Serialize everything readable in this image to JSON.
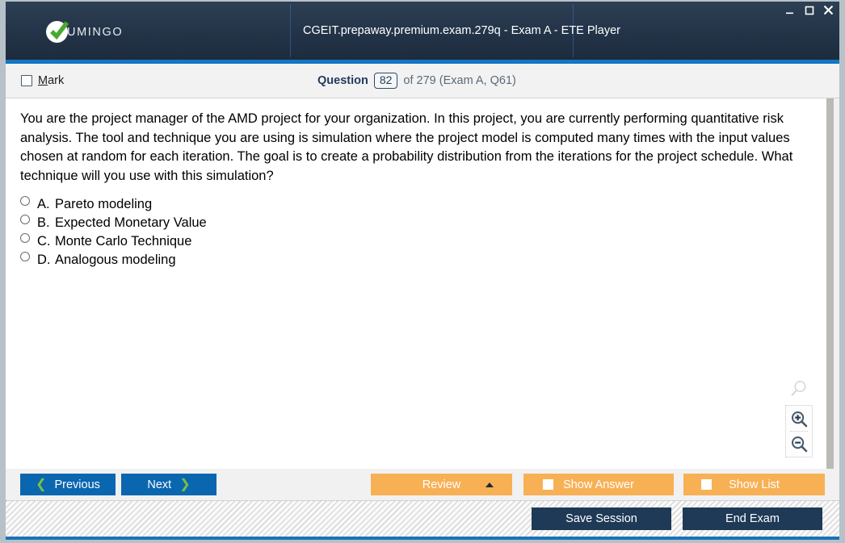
{
  "window": {
    "title": "CGEIT.prepaway.premium.exam.279q - Exam A - ETE Player",
    "brand_name": "UMINGO",
    "controls": {
      "minimize": "minimize-icon",
      "maximize": "maximize-icon",
      "close": "close-icon"
    },
    "accent_color": "#1475c4"
  },
  "question_bar": {
    "mark_label_pre": "",
    "mark_label": "Mark",
    "mark_accesskey": "M",
    "mark_checked": false,
    "question_word": "Question",
    "question_number": "82",
    "question_rest": "of 279 (Exam A, Q61)"
  },
  "question": {
    "text": "You are the project manager of the AMD project for your organization. In this project, you are currently performing quantitative risk analysis. The tool and technique you are using is simulation where the project model is computed many times with the input values chosen at random for each iteration. The goal is to create a probability distribution from the iterations for the project schedule. What technique will you use with this simulation?",
    "options": [
      {
        "letter": "A.",
        "text": "Pareto modeling",
        "selected": false
      },
      {
        "letter": "B.",
        "text": "Expected Monetary Value",
        "selected": false
      },
      {
        "letter": "C.",
        "text": "Monte Carlo Technique",
        "selected": false
      },
      {
        "letter": "D.",
        "text": "Analogous modeling",
        "selected": false
      }
    ]
  },
  "zoom_tools": {
    "loupe": "magnifier-icon",
    "zoom_in": "zoom-in-icon",
    "zoom_out": "zoom-out-icon"
  },
  "toolbar": {
    "previous_label": "Previous",
    "next_label": "Next",
    "review_label": "Review",
    "show_answer_label": "Show Answer",
    "show_list_label": "Show List",
    "nav_color": "#0b66b0",
    "chevron_color": "#7ac143",
    "orange_color": "#f8b055"
  },
  "bottom_bar": {
    "save_session_label": "Save Session",
    "end_exam_label": "End Exam",
    "dark_color": "#1e3a56"
  }
}
